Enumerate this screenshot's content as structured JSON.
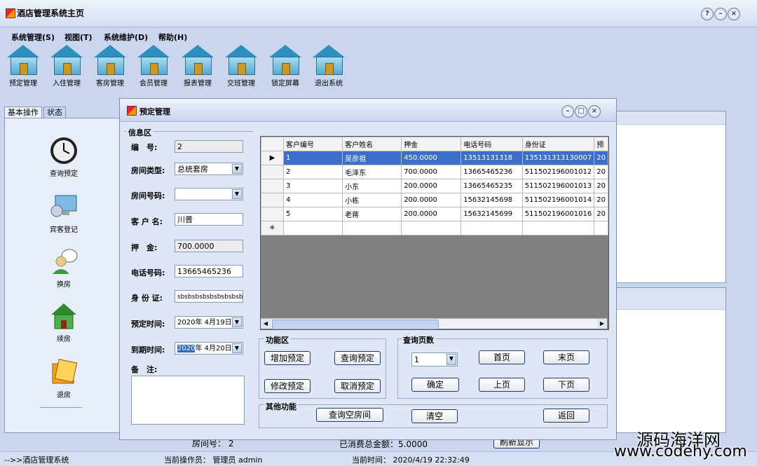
{
  "window": {
    "title": "酒店管理系统主页"
  },
  "menu": [
    "系统管理(S)",
    "视图(T)",
    "系统维护(D)",
    "帮助(H)"
  ],
  "toolbar": [
    "预定管理",
    "入住管理",
    "客房管理",
    "会员管理",
    "报表管理",
    "交班管理",
    "锁定屏幕",
    "退出系统"
  ],
  "left_tabs": [
    "基本操作",
    "状态"
  ],
  "left_buttons": [
    "查询预定",
    "宾客登记",
    "换房",
    "续房",
    "退房"
  ],
  "dialog": {
    "title": "预定管理",
    "info_group": "信息区",
    "fields": {
      "id_label": "编　号:",
      "id_value": "2",
      "room_type_label": "房间类型:",
      "room_type_value": "总统套房",
      "room_no_label": "房间号码:",
      "room_no_value": "",
      "customer_label": "客 户 名:",
      "customer_value": "川普",
      "deposit_label": "押　金:",
      "deposit_value": "700.0000",
      "phone_label": "电话号码:",
      "phone_value": "13665465236",
      "idcard_label": "身 份 证:",
      "idcard_value": "sbsbsbsbsbsbsbsbsb",
      "start_label": "预定时间:",
      "start_value": "2020年 4月19日",
      "end_label": "到期时间:",
      "end_year": "2020",
      "end_value": "年  4月20日",
      "note_label": "备　注:"
    },
    "grid": {
      "columns": [
        "客户编号",
        "客户姓名",
        "押金",
        "电话号码",
        "身份证",
        "预"
      ],
      "rows": [
        [
          "1",
          "吴彦祖",
          "450.0000",
          "13513131318",
          "135131313130007",
          "20"
        ],
        [
          "2",
          "毛泽东",
          "700.0000",
          "13665465236",
          "511502196001012",
          "20"
        ],
        [
          "3",
          "小东",
          "200.0000",
          "13665465235",
          "511502196001013",
          "20"
        ],
        [
          "4",
          "小栋",
          "200.0000",
          "15632145698",
          "511502196001014",
          "20"
        ],
        [
          "5",
          "老蒋",
          "200.0000",
          "15632145699",
          "511502196001016",
          "20"
        ]
      ],
      "new_row_marker": "✳",
      "selected_marker": "▶"
    },
    "func_group": "功能区",
    "func_buttons": [
      "增加预定",
      "查询预定",
      "修改预定",
      "取消预定"
    ],
    "page_group": "查询页数",
    "page_select": "1",
    "page_buttons": {
      "first": "首页",
      "last": "末页",
      "ok": "确定",
      "prev": "上页",
      "next": "下页"
    },
    "other_group": "其他功能",
    "other_buttons": {
      "query_empty": "查询空房间",
      "clear": "清空",
      "back": "返回"
    }
  },
  "bottom_info": {
    "room": "房间号：  2",
    "spent": "已消费总金额：5.0000",
    "refresh": "刷新显示"
  },
  "status": {
    "left": "-->>酒店管理系统",
    "operator": "当前操作员：   管理员  admin",
    "time": "当前时间：   2020/4/19 22:32:49"
  },
  "watermark": {
    "line1": "源码海洋网",
    "line2": "www.codehy.com"
  }
}
